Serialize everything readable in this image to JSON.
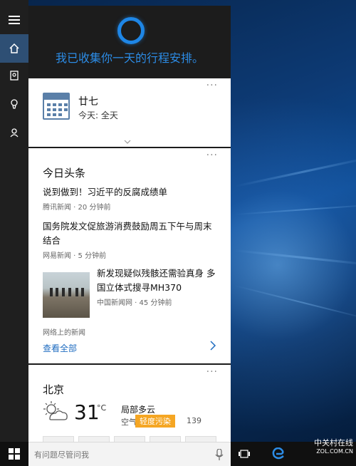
{
  "cortana": {
    "greeting": "我已收集你一天的行程安排。"
  },
  "rail": {
    "items": [
      {
        "name": "menu"
      },
      {
        "name": "home"
      },
      {
        "name": "notebook"
      },
      {
        "name": "reminders"
      },
      {
        "name": "feedback"
      }
    ]
  },
  "calendar_card": {
    "more": "···",
    "date": "廿七",
    "today": "今天: 全天"
  },
  "news_card": {
    "more": "···",
    "title": "今日头条",
    "items": [
      {
        "headline": "说到做到！习近平的反腐成绩单",
        "source": "腾讯新闻 · 20 分钟前"
      },
      {
        "headline1": "国务院发文促旅游消费鼓励周五下午与周末",
        "headline2": "结合",
        "source": "网易新闻 · 5 分钟前"
      },
      {
        "headline1": "新发现疑似残骸还需验真身 多",
        "headline2": "国立体式搜寻MH370",
        "source": "中国新闻网 · 45 分钟前"
      }
    ],
    "footer_label": "网络上的新闻",
    "see_all": "查看全部"
  },
  "weather_card": {
    "more": "···",
    "city": "北京",
    "temperature": "31",
    "unit": "°C",
    "condition": "局部多云",
    "aq_label": "空气",
    "aq_badge": "轻度污染",
    "aqi": "139",
    "colors": {
      "badge": "#f5a623"
    }
  },
  "search": {
    "placeholder": "有问题尽管问我"
  },
  "watermark": {
    "line1": "中关村在线",
    "line2": "ZOL.COM.CN"
  }
}
